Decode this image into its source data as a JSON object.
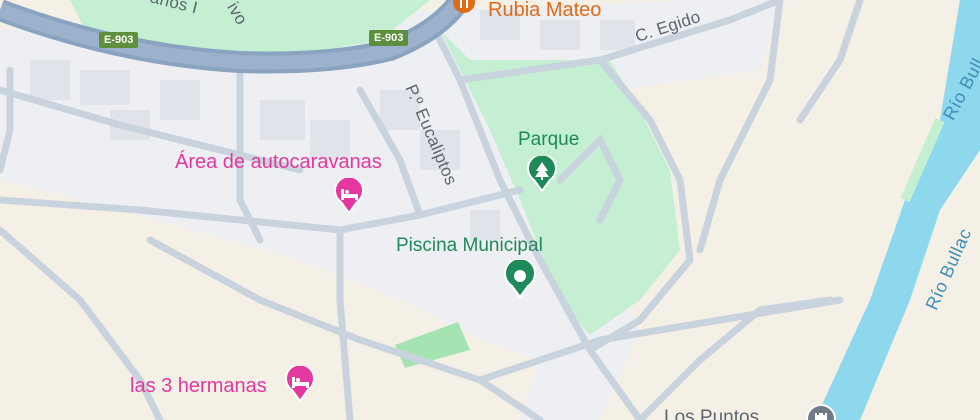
{
  "map": {
    "labels": {
      "rubia_mateo": "Rubia Mateo",
      "c_egido": "C. Egido",
      "p_eucaliptos": "P.º Eucaliptos",
      "parque": "Parque",
      "area_autocaravanas": "Área de autocaravanas",
      "piscina_municipal": "Piscina Municipal",
      "las_3_hermanas": "las 3 hermanas",
      "rio_top": "Río Bull",
      "rio_bottom": "Río Bullac",
      "partial_street": "anos I",
      "partial_street2": "ivo",
      "partial_bottom": "Los Puntos"
    },
    "shields": {
      "left": "E-903",
      "right": "E-903"
    },
    "icons": {
      "lodging": "bed-icon",
      "park": "tree-icon",
      "pool": "dot-pin-icon",
      "restaurant": "restaurant-icon",
      "monument": "castle-icon"
    },
    "colors": {
      "land": "#f5f0e6",
      "urban": "#eeeff2",
      "park": "#c4efd2",
      "water": "#8ed8ee",
      "road": "#c9d3de",
      "highway": "#8aa3c0",
      "poi_pink": "#e3389f",
      "poi_green": "#1e8a5a",
      "poi_orange": "#e06a16"
    }
  }
}
